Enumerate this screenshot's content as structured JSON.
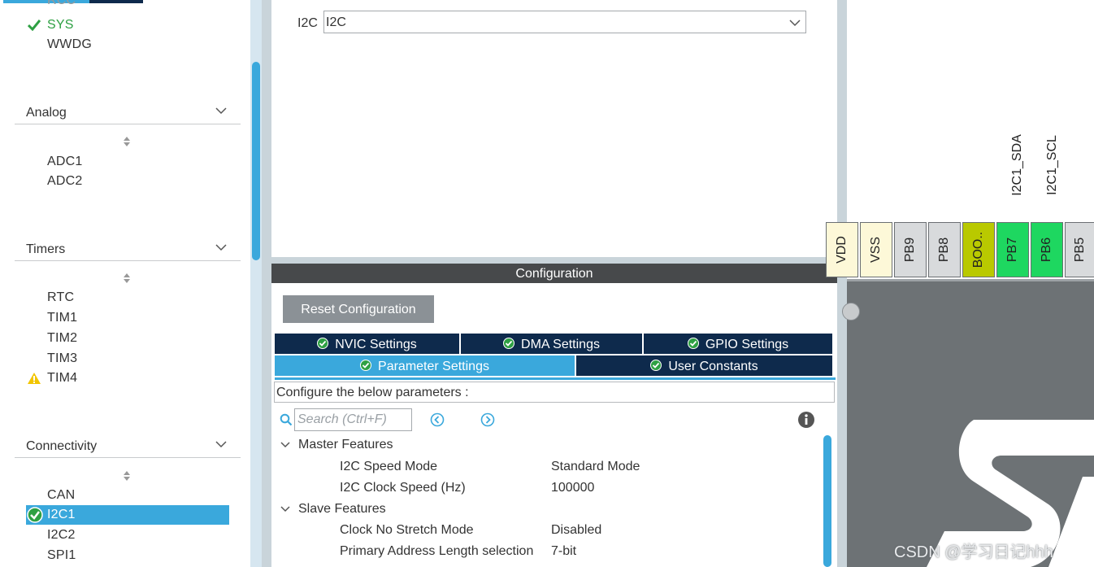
{
  "left_panel": {
    "system_items": [
      {
        "label": "SYS",
        "status": "ok"
      },
      {
        "label": "WWDG",
        "status": "none"
      }
    ],
    "sections": [
      {
        "title": "Analog",
        "items": [
          "ADC1",
          "ADC2"
        ]
      },
      {
        "title": "Timers",
        "items": [
          "RTC",
          "TIM1",
          "TIM2",
          "TIM3",
          "TIM4"
        ],
        "warning_item": "TIM4"
      },
      {
        "title": "Connectivity",
        "items": [
          "CAN",
          "I2C1",
          "I2C2",
          "SPI1"
        ],
        "selected_item": "I2C1"
      }
    ]
  },
  "mode": {
    "label": "I2C",
    "select_value": "I2C"
  },
  "configuration": {
    "header": "Configuration",
    "reset_button": "Reset Configuration",
    "tabs_row1": [
      "NVIC Settings",
      "DMA Settings",
      "GPIO Settings"
    ],
    "tabs_row2": [
      "Parameter Settings",
      "User Constants"
    ],
    "active_tab": "Parameter Settings",
    "configure_text": "Configure the below parameters :",
    "search_placeholder": "Search (Ctrl+F)",
    "groups": [
      {
        "title": "Master Features",
        "params": [
          {
            "name": "I2C Speed Mode",
            "value": "Standard Mode"
          },
          {
            "name": "I2C Clock Speed (Hz)",
            "value": "100000"
          }
        ]
      },
      {
        "title": "Slave Features",
        "params": [
          {
            "name": "Clock No Stretch Mode",
            "value": "Disabled"
          },
          {
            "name": "Primary Address Length selection",
            "value": "7-bit"
          }
        ]
      }
    ]
  },
  "pinout": {
    "signals": [
      "I2C1_SDA",
      "I2C1_SCL"
    ],
    "pins": [
      {
        "name": "VDD",
        "color": "#fdf8d8"
      },
      {
        "name": "VSS",
        "color": "#fdf8d8"
      },
      {
        "name": "PB9",
        "color": "#d8dadc"
      },
      {
        "name": "PB8",
        "color": "#d8dadc"
      },
      {
        "name": "BOO..",
        "color": "#b9c900"
      },
      {
        "name": "PB7",
        "color": "#1ed760"
      },
      {
        "name": "PB6",
        "color": "#1ed760"
      },
      {
        "name": "PB5",
        "color": "#d8dadc"
      }
    ]
  },
  "watermark": "CSDN @学习日记hhh",
  "colors": {
    "accent_blue": "#3aa8dc",
    "navy": "#0e2a4c",
    "ok_green": "#2ea043",
    "warning_yellow": "#f2c500",
    "pin_green": "#1ed760"
  }
}
